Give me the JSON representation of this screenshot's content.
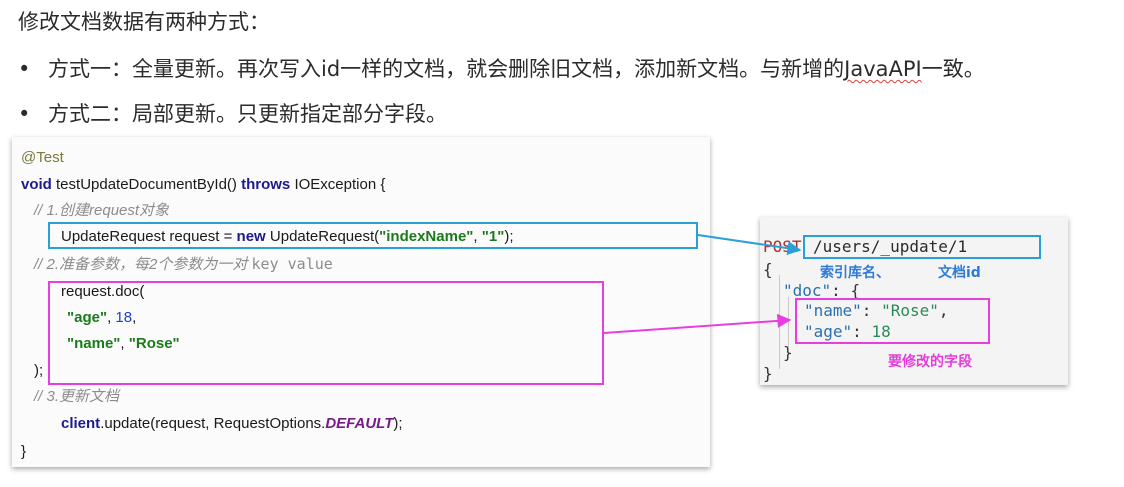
{
  "slide": {
    "heading": "修改文档数据有两种方式：",
    "bullets": [
      {
        "dot": "•",
        "text_before": "方式一：全量更新。再次写入id一样的文档，就会删除旧文档，添加新文档。与新增的",
        "text_underlined": "JavaAPI",
        "text_after": "一致。"
      },
      {
        "dot": "•",
        "text": "方式二：局部更新。只更新指定部分字段。"
      }
    ]
  },
  "code": {
    "annotation": "@Test",
    "sig_void": "void",
    "sig_name": " testUpdateDocumentById() ",
    "sig_throws": "throws",
    "sig_rest": " IOException {",
    "comment1": "// 1.创建request对象",
    "l2_a": "UpdateRequest request = ",
    "l2_new": "new",
    "l2_b": " UpdateRequest(",
    "l2_s1": "\"indexName\"",
    "l2_c": ", ",
    "l2_s2": "\"1\"",
    "l2_d": ");",
    "comment2_a": "// 2.准备参数，每2个参数为一对 ",
    "comment2_b": "key value",
    "l3": "request.doc(",
    "l4_key": "\"age\"",
    "l4_sep": ", ",
    "l4_val": "18",
    "l4_end": ",",
    "l5_key": "\"name\"",
    "l5_sep": ", ",
    "l5_val": "\"Rose\"",
    "l6": ");",
    "comment3": "// 3.更新文档",
    "l7_client": "client",
    "l7_a": ".update(request, RequestOptions.",
    "l7_const": "DEFAULT",
    "l7_b": ");",
    "closing": "}"
  },
  "json": {
    "method": "POST",
    "url": "/users/_update/1",
    "open": "{",
    "label_index": "索引库名、",
    "label_id": "文档id",
    "doc_key": "\"doc\"",
    "doc_open": ": {",
    "name_key": "\"name\"",
    "name_val": "\"Rose\"",
    "age_key": "\"age\"",
    "age_val": "18",
    "inner_close": "}",
    "outer_close": "}",
    "label_fields": "要修改的字段"
  },
  "colors": {
    "blue_highlight": "#2aa0d8",
    "pink_highlight": "#e83ee0"
  }
}
